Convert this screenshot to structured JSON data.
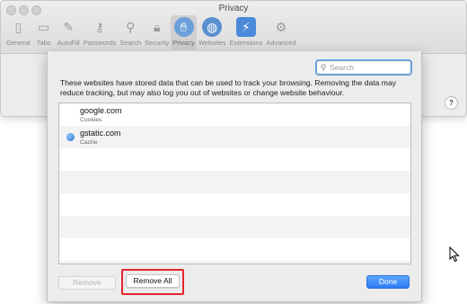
{
  "window": {
    "title": "Privacy"
  },
  "toolbar": {
    "items": [
      {
        "label": "General",
        "icon": "switch-icon"
      },
      {
        "label": "Tabs",
        "icon": "tabs-icon"
      },
      {
        "label": "AutoFill",
        "icon": "pencil-icon"
      },
      {
        "label": "Passwords",
        "icon": "key-icon"
      },
      {
        "label": "Search",
        "icon": "magnifier-icon"
      },
      {
        "label": "Security",
        "icon": "lock-icon"
      },
      {
        "label": "Privacy",
        "icon": "hand-icon"
      },
      {
        "label": "Websites",
        "icon": "globe-icon"
      },
      {
        "label": "Extensions",
        "icon": "puzzle-icon"
      },
      {
        "label": "Advanced",
        "icon": "gear-icon"
      }
    ],
    "active": "Privacy"
  },
  "help": {
    "label": "?"
  },
  "sheet": {
    "search": {
      "placeholder": "Search",
      "value": ""
    },
    "description": "These websites have stored data that can be used to track your browsing. Removing the data may reduce tracking, but may also log you out of websites or change website behaviour.",
    "sites": [
      {
        "name": "google.com",
        "kind": "Cookies",
        "has_icon": false
      },
      {
        "name": "gstatic.com",
        "kind": "Cache",
        "has_icon": true
      }
    ],
    "buttons": {
      "remove": "Remove",
      "remove_all": "Remove All",
      "done": "Done"
    }
  },
  "colors": {
    "accent": "#2d7cf6",
    "highlight": "#e8232b"
  }
}
